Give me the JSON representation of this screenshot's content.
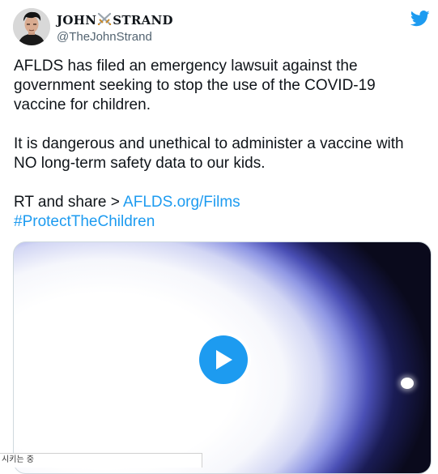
{
  "author": {
    "display_name_first": "JOHN",
    "display_name_last": "STRAND",
    "handle": "@TheJohnStrand",
    "avatar_icon": "person-portrait-icon",
    "name_emoji_icon": "crossed-swords-icon"
  },
  "brand": {
    "logo_icon": "twitter-bird-icon",
    "color": "#1d9bf0"
  },
  "tweet": {
    "paragraph1": "AFLDS has filed an emergency lawsuit against the government seeking to stop the use of the COVID-19 vaccine for children.",
    "paragraph2": "It is dangerous and unethical to administer a vaccine with NO long-term safety data to our kids.",
    "paragraph3_prefix": "RT and share > ",
    "link": "AFLDS.org/Films",
    "hashtag": "#ProtectTheChildren"
  },
  "media": {
    "type": "video",
    "play_icon": "play-icon"
  },
  "overlay": {
    "text": "시키는 중"
  }
}
